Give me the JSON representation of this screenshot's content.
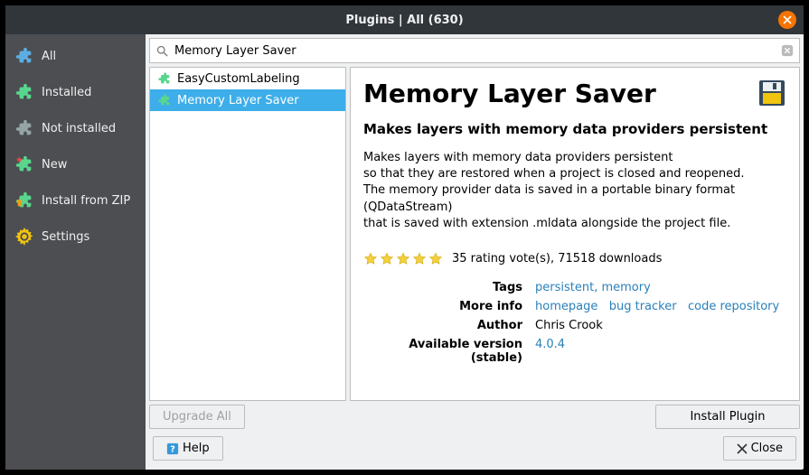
{
  "title": "Plugins | All (630)",
  "sidebar": {
    "items": [
      {
        "label": "All",
        "icon": "puzzle-all"
      },
      {
        "label": "Installed",
        "icon": "puzzle-green"
      },
      {
        "label": "Not installed",
        "icon": "puzzle-grey"
      },
      {
        "label": "New",
        "icon": "puzzle-new"
      },
      {
        "label": "Install from ZIP",
        "icon": "puzzle-zip"
      },
      {
        "label": "Settings",
        "icon": "gear"
      }
    ]
  },
  "search": {
    "value": "Memory Layer Saver"
  },
  "results": [
    {
      "label": "EasyCustomLabeling",
      "selected": false
    },
    {
      "label": "Memory Layer Saver",
      "selected": true
    }
  ],
  "plugin": {
    "name": "Memory Layer Saver",
    "subtitle": "Makes layers with memory data providers persistent",
    "description_lines": [
      "Makes layers with memory data providers persistent",
      "so that they are restored when a project is closed and reopened.",
      "The memory provider data is saved in a portable binary format (QDataStream)",
      "that is saved with extension .mldata alongside the project file."
    ],
    "rating_text": "35 rating vote(s), 71518 downloads",
    "tags_label": "Tags",
    "tags": [
      "persistent",
      "memory"
    ],
    "moreinfo_label": "More info",
    "moreinfo": [
      "homepage",
      "bug tracker",
      "code repository"
    ],
    "author_label": "Author",
    "author": "Chris Crook",
    "version_label": "Available version (stable)",
    "version": "4.0.4"
  },
  "buttons": {
    "upgrade_all": "Upgrade All",
    "install": "Install Plugin",
    "help": "Help",
    "close": "Close"
  }
}
